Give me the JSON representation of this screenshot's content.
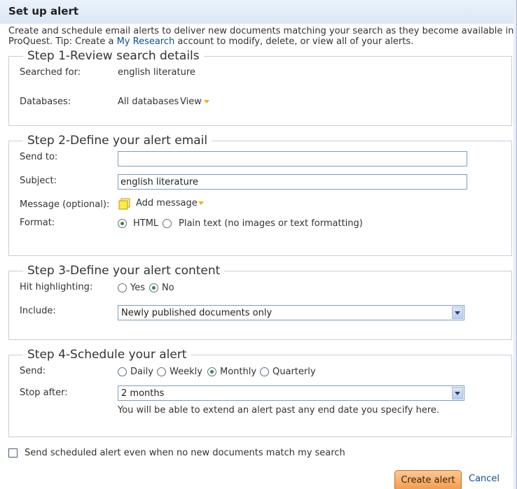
{
  "dialog": {
    "title": "Set up alert",
    "intro_line1": "Create and schedule email alerts to deliver new documents matching your search as they become available in",
    "intro_line2_prefix": "ProQuest. Tip: Create a ",
    "intro_link": "My Research",
    "intro_line2_suffix": " account to modify, delete, or view all of your alerts."
  },
  "step1": {
    "legend": "Step 1-Review search details",
    "searched_for_label": "Searched for:",
    "searched_for_value": "english literature",
    "databases_label": "Databases:",
    "databases_value": "All databases",
    "view_link": "View"
  },
  "step2": {
    "legend": "Step 2-Define your alert email",
    "send_to_label": "Send to:",
    "send_to_value": "",
    "subject_label": "Subject:",
    "subject_value": "english literature",
    "message_label": "Message (optional):",
    "add_message_link": "Add message",
    "format_label": "Format:",
    "format_html": "HTML",
    "format_plain": "Plain text (no images or text formatting)",
    "format_selected": "HTML"
  },
  "step3": {
    "legend": "Step 3-Define your alert content",
    "hit_label": "Hit highlighting:",
    "hit_yes": "Yes",
    "hit_no": "No",
    "hit_selected": "No",
    "include_label": "Include:",
    "include_value": "Newly published documents only"
  },
  "step4": {
    "legend": "Step 4-Schedule your alert",
    "send_label": "Send:",
    "freq_daily": "Daily",
    "freq_weekly": "Weekly",
    "freq_monthly": "Monthly",
    "freq_quarterly": "Quarterly",
    "freq_selected": "Monthly",
    "stop_label": "Stop after:",
    "stop_value": "2 months",
    "stop_note": "You will be able to extend an alert past any end date you specify here."
  },
  "footer": {
    "send_always_label": "Send scheduled alert even when no new documents match my search",
    "create_button": "Create alert",
    "cancel_link": "Cancel"
  },
  "colors": {
    "link": "#0b4f9c",
    "accent_button": "#f19a4a",
    "radio_selected": "#2e8b3d",
    "caret": "#f0b400"
  }
}
